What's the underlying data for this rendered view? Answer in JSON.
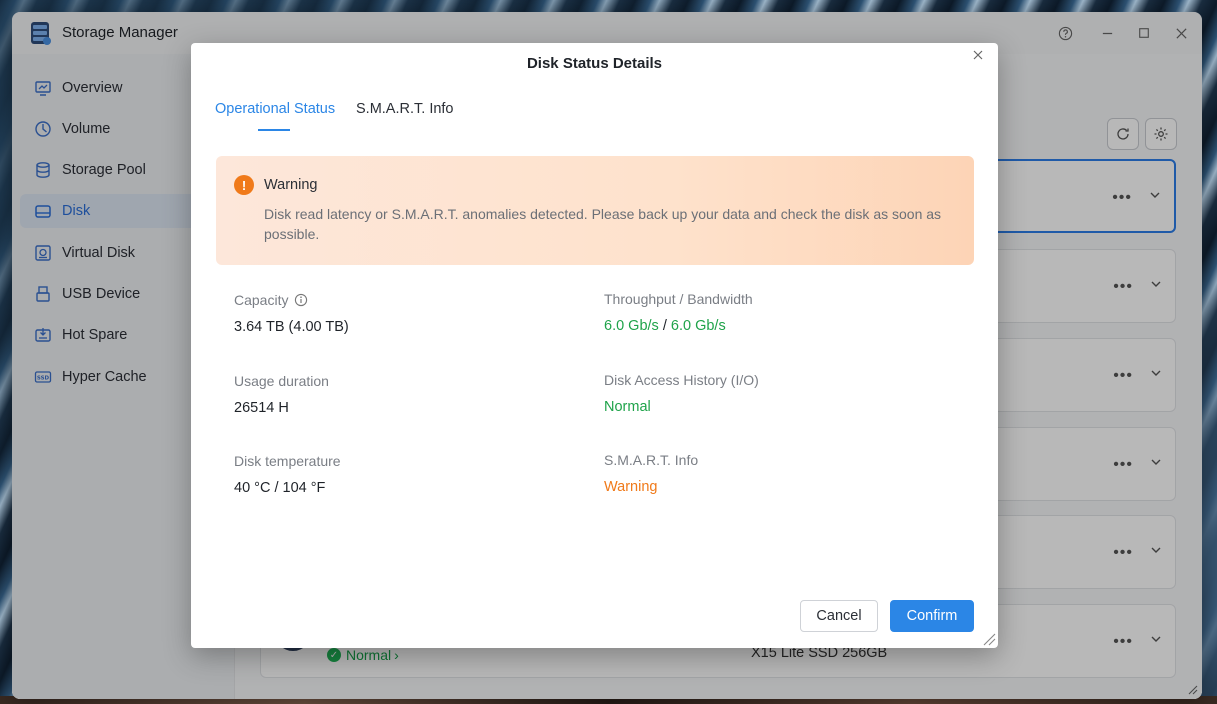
{
  "app": {
    "title": "Storage Manager",
    "icons": {
      "help": "help-circle-icon",
      "minimize": "minimize-icon",
      "maximize": "maximize-icon",
      "close": "close-icon"
    }
  },
  "sidebar": {
    "items": [
      {
        "label": "Overview",
        "icon": "monitor-chart-icon",
        "active": false
      },
      {
        "label": "Volume",
        "icon": "clock-pie-icon",
        "active": false
      },
      {
        "label": "Storage Pool",
        "icon": "database-icon",
        "active": false
      },
      {
        "label": "Disk",
        "icon": "hard-drive-icon",
        "active": true
      },
      {
        "label": "Virtual Disk",
        "icon": "virtual-disk-icon",
        "active": false
      },
      {
        "label": "USB Device",
        "icon": "usb-icon",
        "active": false
      },
      {
        "label": "Hot Spare",
        "icon": "hot-spare-icon",
        "active": false
      },
      {
        "label": "Hyper Cache",
        "icon": "ssd-icon",
        "active": false
      }
    ]
  },
  "background_list": {
    "last_card": {
      "status": "Normal",
      "model": "X15 Lite SSD 256GB"
    }
  },
  "dialog": {
    "title": "Disk Status Details",
    "tabs": [
      {
        "label": "Operational Status",
        "active": true
      },
      {
        "label": "S.M.A.R.T. Info",
        "active": false
      }
    ],
    "warning": {
      "title": "Warning",
      "icon": "exclamation-icon",
      "message": "Disk read latency or S.M.A.R.T. anomalies detected. Please back up your data and check the disk as soon as possible."
    },
    "fields": {
      "capacity": {
        "label": "Capacity",
        "value": "3.64 TB (4.00 TB)"
      },
      "usage": {
        "label": "Usage duration",
        "value": "26514 H"
      },
      "temperature": {
        "label": "Disk temperature",
        "value": "40 °C / 104 °F"
      },
      "throughput": {
        "label": "Throughput / Bandwidth",
        "value_a": "6.0 Gb/s",
        "separator": "/",
        "value_b": "6.0 Gb/s"
      },
      "access_history": {
        "label": "Disk Access History (I/O)",
        "value": "Normal"
      },
      "smart": {
        "label": "S.M.A.R.T. Info",
        "value": "Warning"
      }
    },
    "buttons": {
      "cancel": "Cancel",
      "confirm": "Confirm"
    }
  },
  "colors": {
    "accent": "#2b86e6",
    "ok": "#1fa34a",
    "warn": "#f07a1a"
  }
}
